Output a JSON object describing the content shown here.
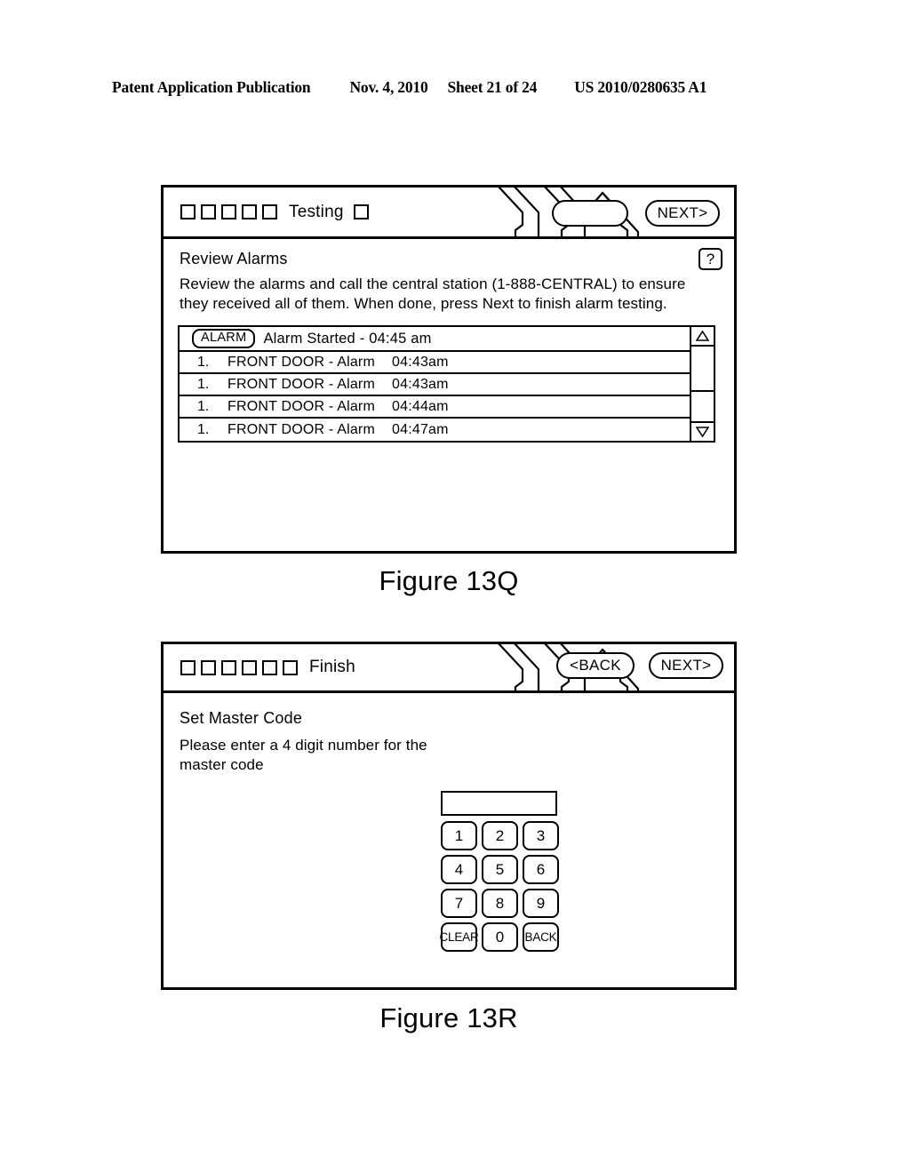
{
  "patent_header": {
    "publication": "Patent Application Publication",
    "date": "Nov. 4, 2010",
    "sheet": "Sheet 21 of 24",
    "number": "US 2010/0280635 A1"
  },
  "figures": [
    {
      "caption": "Figure 13Q",
      "titlebar": {
        "steps_before": 5,
        "label": "Testing",
        "steps_after": 1,
        "logo": "house-roof-logo"
      },
      "screen": {
        "title": "Review Alarms",
        "paragraph": "Review the alarms and call the central station (1-888-CENTRAL) to ensure they received all of them. When done, press Next to finish alarm testing.",
        "help_label": "?",
        "list": {
          "badge": "ALARM",
          "header_text": "Alarm Started - 04:45 am",
          "columns": [
            "index",
            "name",
            "time"
          ],
          "rows": [
            {
              "index": "1.",
              "name": "FRONT DOOR - Alarm",
              "time": "04:43am"
            },
            {
              "index": "1.",
              "name": "FRONT DOOR - Alarm",
              "time": "04:43am"
            },
            {
              "index": "1.",
              "name": "FRONT DOOR - Alarm",
              "time": "04:44am"
            },
            {
              "index": "1.",
              "name": "FRONT DOOR - Alarm",
              "time": "04:47am"
            }
          ],
          "scrollbar": {
            "up_icon": "triangle-up-icon",
            "down_icon": "triangle-down-icon",
            "thumb_percent": 61
          }
        },
        "buttons": {
          "blank": "",
          "next": "NEXT>"
        }
      }
    },
    {
      "caption": "Figure 13R",
      "titlebar": {
        "steps_before": 6,
        "label": "Finish",
        "steps_after": 0,
        "logo": "house-roof-logo"
      },
      "screen": {
        "title": "Set Master Code",
        "paragraph": "Please enter a 4 digit number for the master code",
        "code_value": "",
        "keypad": [
          [
            "1",
            "2",
            "3"
          ],
          [
            "4",
            "5",
            "6"
          ],
          [
            "7",
            "8",
            "9"
          ],
          [
            "CLEAR",
            "0",
            "BACK"
          ]
        ],
        "buttons": {
          "back": "<BACK",
          "next": "NEXT>"
        }
      }
    }
  ]
}
